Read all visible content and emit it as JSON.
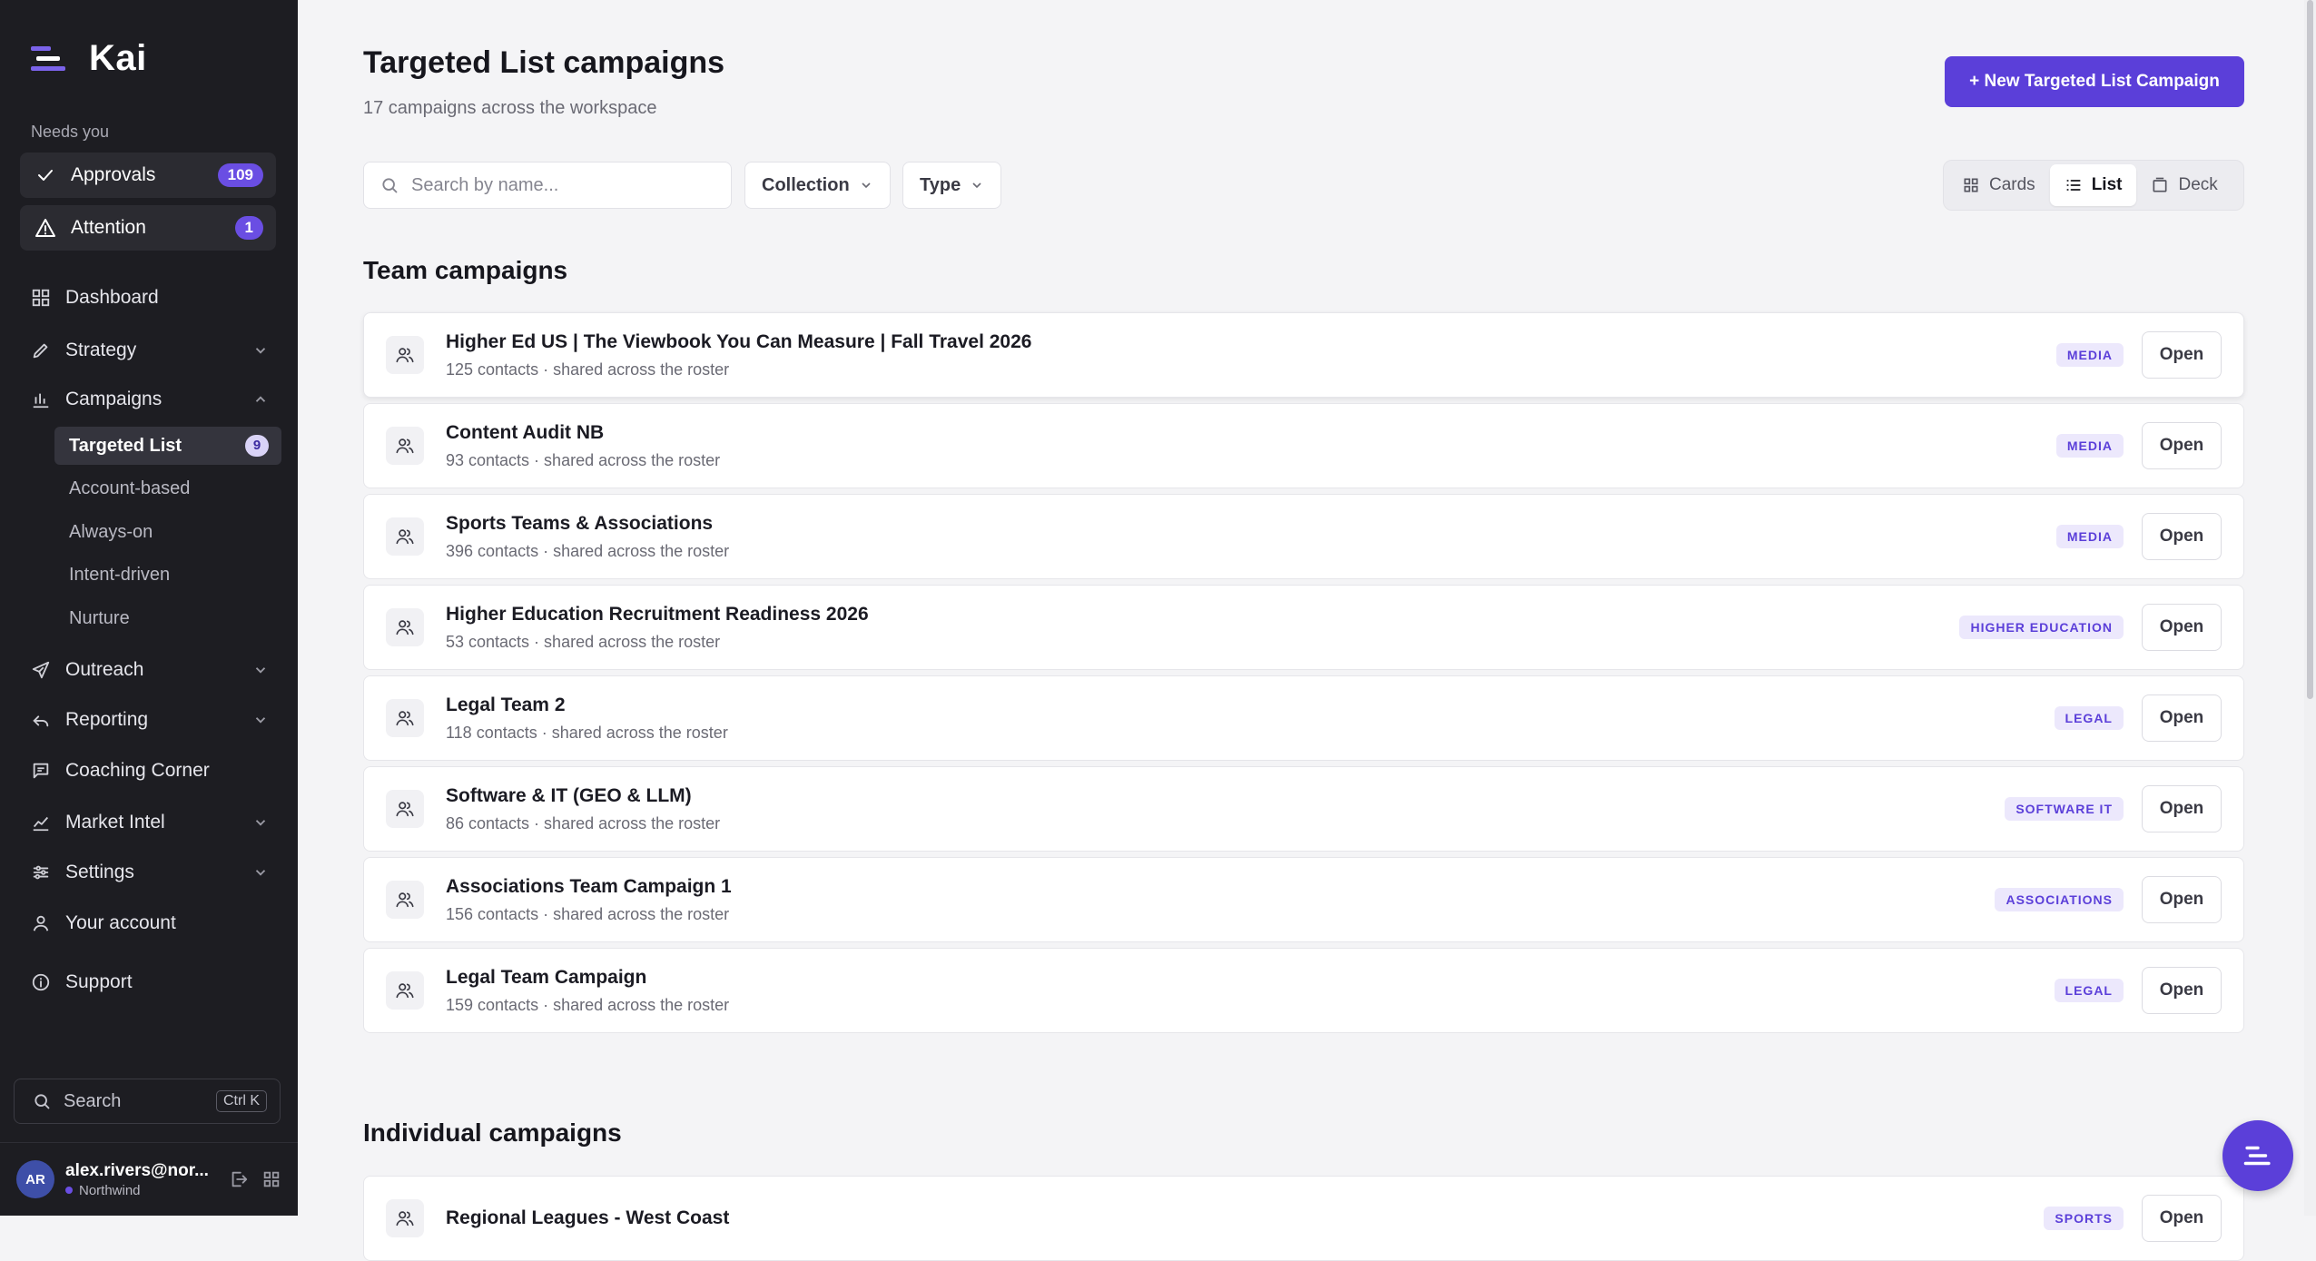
{
  "app": {
    "name": "Kai"
  },
  "sidebar": {
    "needs_label": "Needs you",
    "needs": [
      {
        "label": "Approvals",
        "count": "109",
        "icon": "check-icon"
      },
      {
        "label": "Attention",
        "count": "1",
        "icon": "warning-icon"
      }
    ],
    "nav": {
      "dashboard": "Dashboard",
      "strategy": "Strategy",
      "campaigns": "Campaigns",
      "campaign_subitems": [
        {
          "label": "Targeted List",
          "count": "9",
          "active": true
        },
        {
          "label": "Account-based"
        },
        {
          "label": "Always-on"
        },
        {
          "label": "Intent-driven"
        },
        {
          "label": "Nurture"
        }
      ],
      "outreach": "Outreach",
      "reporting": "Reporting",
      "coaching": "Coaching Corner",
      "market_intel": "Market Intel",
      "settings": "Settings",
      "account": "Your account",
      "support": "Support"
    },
    "search": {
      "label": "Search",
      "shortcut": "Ctrl K"
    },
    "user": {
      "initials": "AR",
      "email": "alex.rivers@nor...",
      "org": "Northwind"
    }
  },
  "main": {
    "title": "Targeted List campaigns",
    "subtitle": "17 campaigns across the workspace",
    "new_button": "+ New Targeted List Campaign",
    "search_placeholder": "Search by name...",
    "filters": {
      "collection": "Collection",
      "type": "Type"
    },
    "views": {
      "cards": "Cards",
      "list": "List",
      "deck": "Deck",
      "active": "list"
    },
    "team_section": "Team campaigns",
    "individual_section": "Individual campaigns",
    "open_label": "Open",
    "team_campaigns": [
      {
        "title": "Higher Ed US | The Viewbook You Can Measure | Fall Travel 2026",
        "meta": "125 contacts · shared across the roster",
        "tag": "MEDIA"
      },
      {
        "title": "Content Audit NB",
        "meta": "93 contacts · shared across the roster",
        "tag": "MEDIA"
      },
      {
        "title": "Sports Teams & Associations",
        "meta": "396 contacts · shared across the roster",
        "tag": "MEDIA"
      },
      {
        "title": "Higher Education Recruitment Readiness 2026",
        "meta": "53 contacts · shared across the roster",
        "tag": "HIGHER EDUCATION"
      },
      {
        "title": "Legal Team 2",
        "meta": "118 contacts · shared across the roster",
        "tag": "LEGAL"
      },
      {
        "title": "Software & IT (GEO & LLM)",
        "meta": "86 contacts · shared across the roster",
        "tag": "SOFTWARE IT"
      },
      {
        "title": "Associations Team Campaign 1",
        "meta": "156 contacts · shared across the roster",
        "tag": "ASSOCIATIONS"
      },
      {
        "title": "Legal Team Campaign",
        "meta": "159 contacts · shared across the roster",
        "tag": "LEGAL"
      }
    ],
    "individual_campaigns": [
      {
        "title": "Regional Leagues - West Coast",
        "tag": "SPORTS"
      }
    ]
  },
  "colors": {
    "accent": "#5b3fd9",
    "sidebar_bg": "#1d1d22",
    "page_bg": "#f4f4f6"
  }
}
